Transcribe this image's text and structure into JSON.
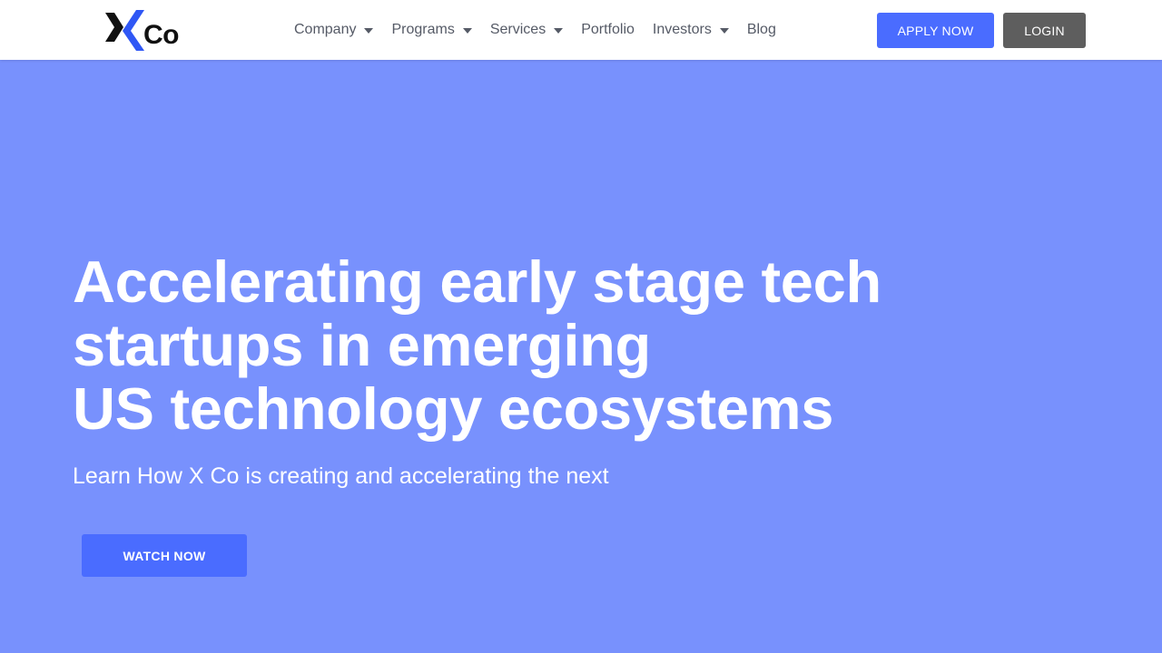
{
  "header": {
    "logo": {
      "icon": "x-logo-icon",
      "text": "Co",
      "colors": {
        "dark": "#111111",
        "blue": "#2f57f5"
      }
    },
    "nav": [
      {
        "label": "Company",
        "has_dropdown": true
      },
      {
        "label": "Programs",
        "has_dropdown": true
      },
      {
        "label": "Services",
        "has_dropdown": true
      },
      {
        "label": "Portfolio",
        "has_dropdown": false
      },
      {
        "label": "Investors",
        "has_dropdown": true
      },
      {
        "label": "Blog",
        "has_dropdown": false
      }
    ],
    "apply_label": "APPLY NOW",
    "login_label": "LOGIN"
  },
  "hero": {
    "title_lines": [
      "Accelerating early stage tech",
      "startups in emerging",
      "US technology ecosystems"
    ],
    "subtitle": "Learn How X Co is creating and accelerating the next",
    "watch_label": "WATCH NOW"
  },
  "colors": {
    "hero_bg": "#7891fd",
    "accent": "#4a6cff",
    "login_bg": "#5e5e5e",
    "nav_text": "#555a66"
  }
}
